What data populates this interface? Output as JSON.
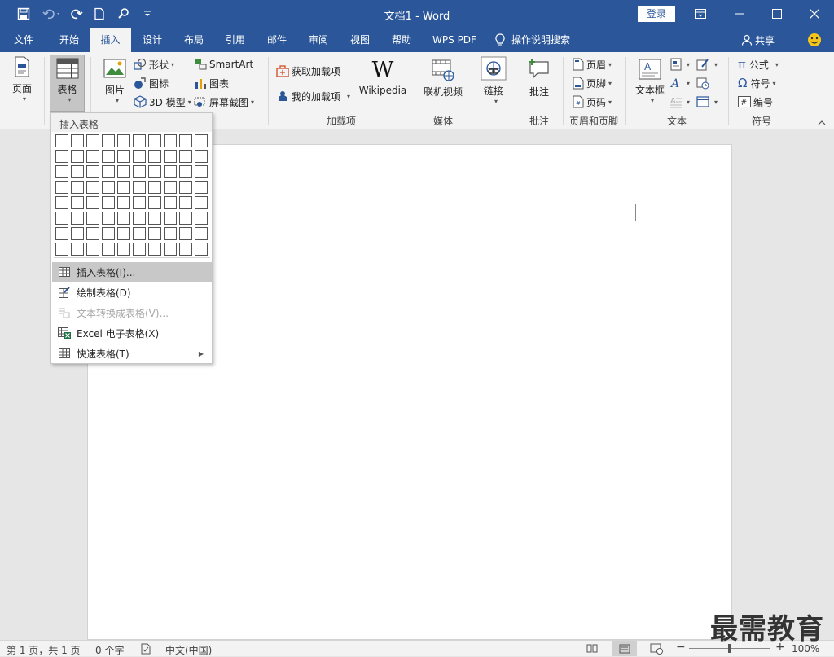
{
  "titlebar": {
    "doc_title": "文档1  -  Word",
    "login": "登录"
  },
  "tabs": [
    "文件",
    "开始",
    "插入",
    "设计",
    "布局",
    "引用",
    "邮件",
    "审阅",
    "视图",
    "帮助",
    "WPS PDF"
  ],
  "tell_me": "操作说明搜索",
  "share": "共享",
  "ribbon": {
    "page": "页面",
    "table": "表格",
    "picture": "图片",
    "shapes": "形状",
    "icons": "图标",
    "model3d": "3D 模型",
    "smartart": "SmartArt",
    "chart": "图表",
    "screenshot": "屏幕截图",
    "get_addins": "获取加载项",
    "my_addins": "我的加载项",
    "wikipedia": "Wikipedia",
    "addins_group": "加载项",
    "online_video": "联机视频",
    "media_group": "媒体",
    "link": "链接",
    "comment": "批注",
    "comment_group": "批注",
    "header": "页眉",
    "footer": "页脚",
    "page_number": "页码",
    "hf_group": "页眉和页脚",
    "textbox": "文本框",
    "text_group": "文本",
    "equation": "公式",
    "symbol": "符号",
    "numbering": "编号",
    "symbols_group": "符号"
  },
  "table_menu": {
    "title": "插入表格",
    "items": [
      {
        "label": "插入表格(I)..."
      },
      {
        "label": "绘制表格(D)"
      },
      {
        "label": "文本转换成表格(V)..."
      },
      {
        "label": "Excel 电子表格(X)"
      },
      {
        "label": "快速表格(T)"
      }
    ]
  },
  "status": {
    "page": "第 1 页，共 1 页",
    "words": "0 个字",
    "lang": "中文(中国)",
    "zoom": "100%"
  },
  "watermark": "最需教育"
}
